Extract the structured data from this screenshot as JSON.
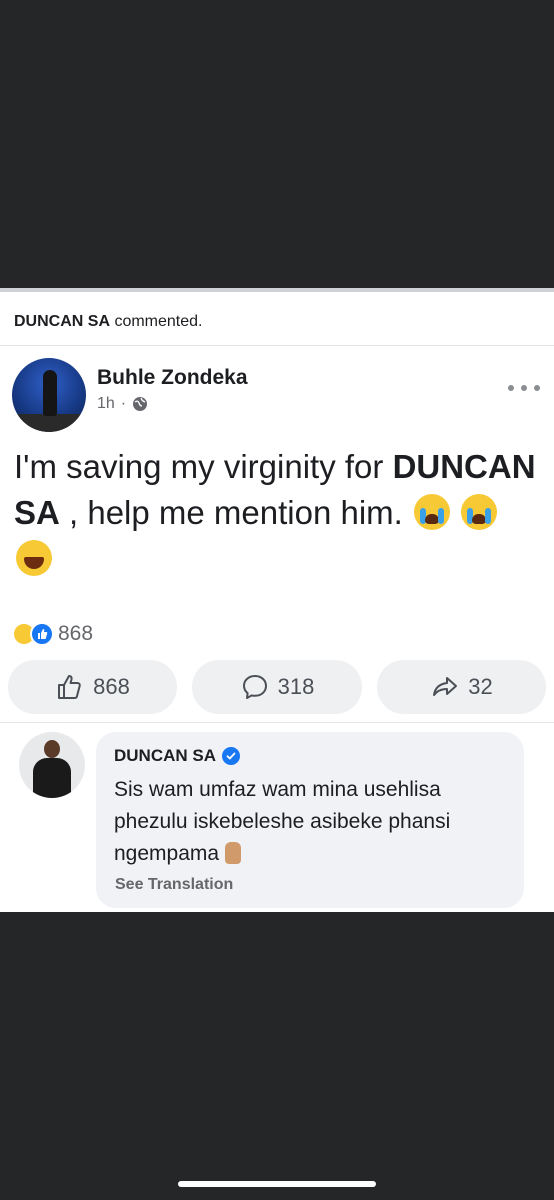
{
  "activity": {
    "actor": "DUNCAN SA",
    "action": "commented."
  },
  "post": {
    "author": "Buhle Zondeka",
    "time": "1h",
    "separator": "·",
    "text_before": "I'm saving my virginity for ",
    "mention": "DUNCAN SA",
    "text_after": " , help me mention him.",
    "emojis": [
      "loudly-crying-face",
      "loudly-crying-face",
      "face-with-tears-of-joy"
    ],
    "reaction_count": "868"
  },
  "actions": {
    "like_count": "868",
    "comment_count": "318",
    "share_count": "32"
  },
  "comment": {
    "author": "DUNCAN SA",
    "verified": true,
    "text": "Sis wam umfaz wam mina usehlisa phezulu iskebeleshe asibeke phansi ngempama",
    "emoji": "crossed-fingers",
    "see_translation": "See Translation"
  },
  "colors": {
    "background_dark": "#252627",
    "card": "#ffffff",
    "button_bg": "#eff0f2",
    "text_primary": "#1c1e21",
    "text_secondary": "#65676b",
    "brand_blue": "#1877f2"
  }
}
